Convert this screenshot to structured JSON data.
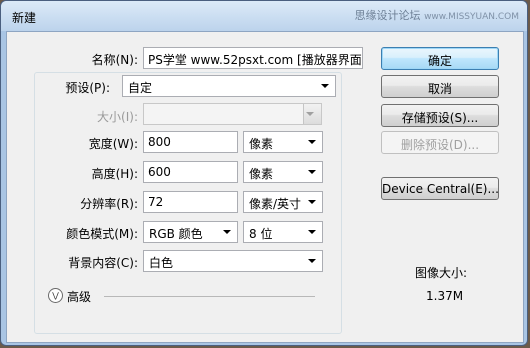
{
  "window": {
    "title": "新建"
  },
  "watermark": {
    "text": "思缘设计论坛",
    "small": "www.MISSYUAN.COM"
  },
  "form": {
    "name": {
      "label": "名称(N):",
      "value": "PS学堂 www.52psxt.com [播放器界面]"
    },
    "preset": {
      "label": "预设(P):",
      "value": "自定"
    },
    "size": {
      "label": "大小(I):",
      "value": ""
    },
    "width": {
      "label": "宽度(W):",
      "value": "800",
      "unit": "像素"
    },
    "height": {
      "label": "高度(H):",
      "value": "600",
      "unit": "像素"
    },
    "resolution": {
      "label": "分辨率(R):",
      "value": "72",
      "unit": "像素/英寸"
    },
    "color_mode": {
      "label": "颜色模式(M):",
      "value": "RGB 颜色",
      "depth": "8 位"
    },
    "background": {
      "label": "背景内容(C):",
      "value": "白色"
    },
    "advanced": {
      "label": "高级"
    }
  },
  "buttons": {
    "ok": "确定",
    "cancel": "取消",
    "save_preset": "存储预设(S)...",
    "delete_preset": "删除预设(D)...",
    "device_central": "Device Central(E)..."
  },
  "image_size": {
    "label": "图像大小:",
    "value": "1.37M"
  },
  "icons": {
    "advanced_toggle": "chevron-down-circle-icon",
    "dropdown_arrow": "triangle-down-icon"
  }
}
